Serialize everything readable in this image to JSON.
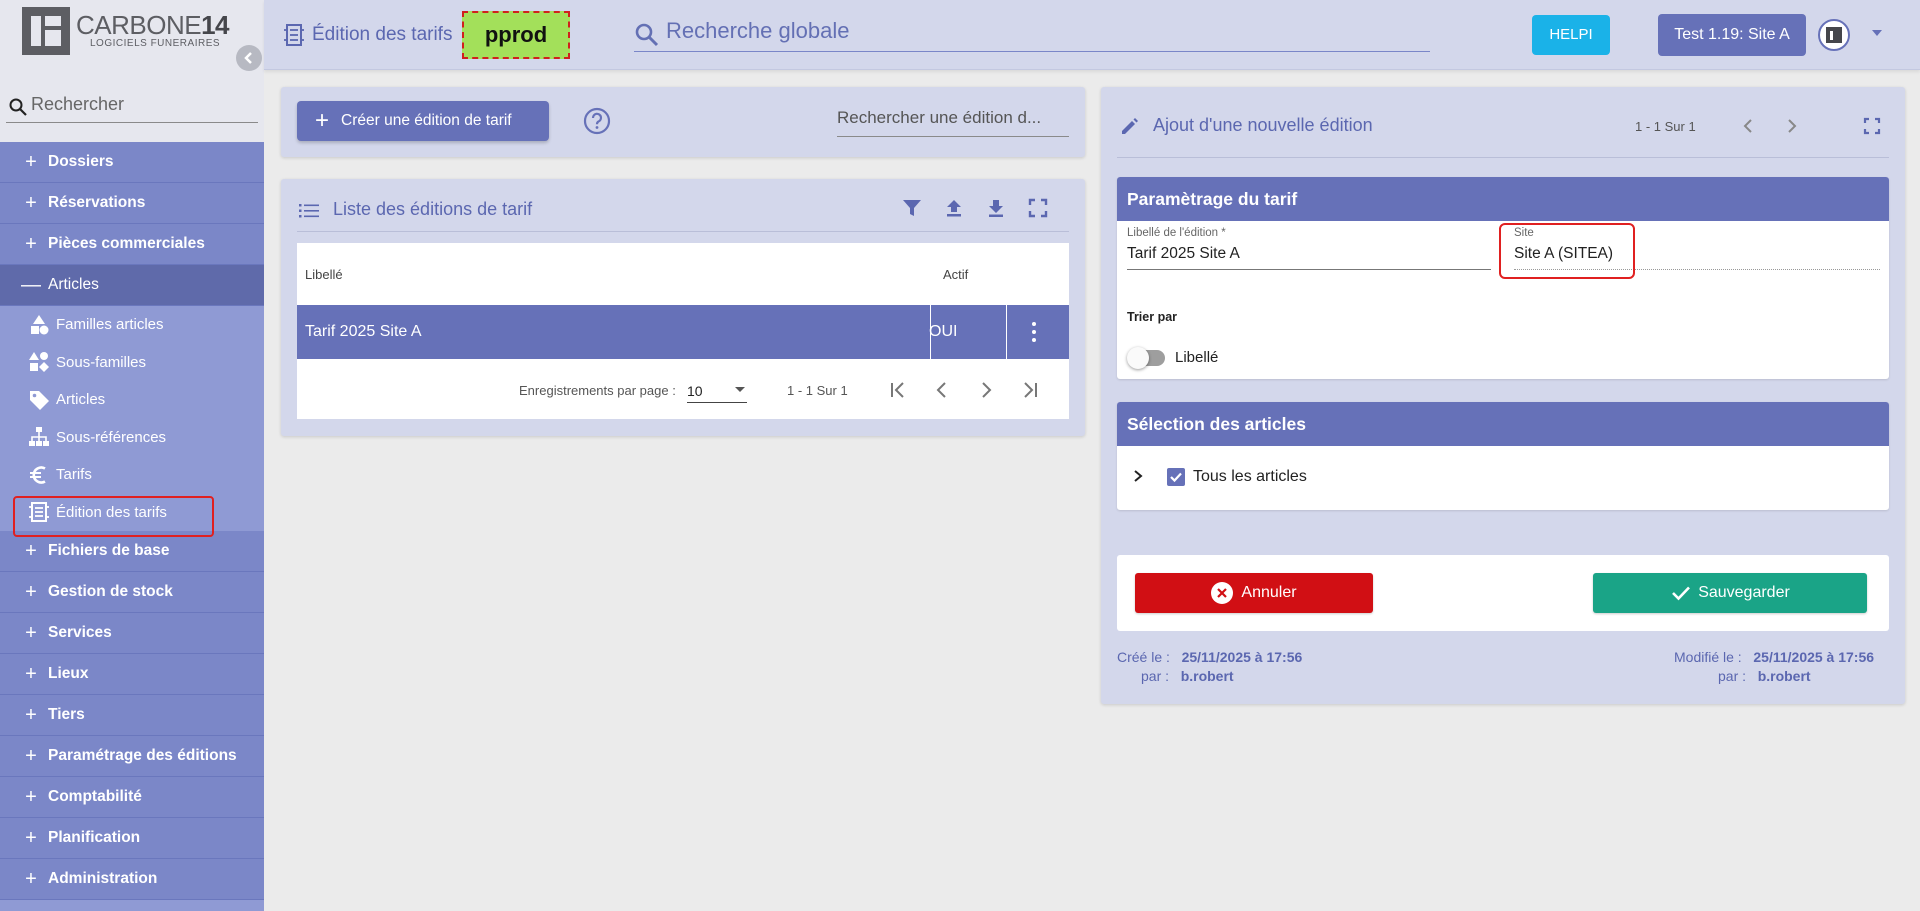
{
  "brand": {
    "name_light": "CARBONE",
    "name_bold": "14",
    "tagline": "LOGICIELS FUNERAIRES"
  },
  "sidebar": {
    "search_placeholder": "Rechercher",
    "items": [
      {
        "label": "Dossiers",
        "symbol": "+"
      },
      {
        "label": "Réservations",
        "symbol": "+"
      },
      {
        "label": "Pièces commerciales",
        "symbol": "+"
      },
      {
        "label": "Articles",
        "symbol": "—"
      },
      {
        "label": "Fichiers de base",
        "symbol": "+"
      },
      {
        "label": "Gestion de stock",
        "symbol": "+"
      },
      {
        "label": "Services",
        "symbol": "+"
      },
      {
        "label": "Lieux",
        "symbol": "+"
      },
      {
        "label": "Tiers",
        "symbol": "+"
      },
      {
        "label": "Paramétrage des éditions",
        "symbol": "+"
      },
      {
        "label": "Comptabilité",
        "symbol": "+"
      },
      {
        "label": "Planification",
        "symbol": "+"
      },
      {
        "label": "Administration",
        "symbol": "+"
      }
    ],
    "subitems": [
      {
        "label": "Familles articles",
        "icon": "shapes-icon"
      },
      {
        "label": "Sous-familles",
        "icon": "shapes-multi-icon"
      },
      {
        "label": "Articles",
        "icon": "tag-icon"
      },
      {
        "label": "Sous-références",
        "icon": "sitemap-icon"
      },
      {
        "label": "Tarifs",
        "icon": "euro-icon"
      },
      {
        "label": "Édition des tarifs",
        "icon": "receipt-icon"
      }
    ]
  },
  "header": {
    "title": "Édition des tarifs",
    "env_badge": "pprod",
    "search_placeholder": "Recherche globale",
    "helpi_label": "HELPI",
    "site_label": "Test 1.19: Site A"
  },
  "toolbar": {
    "create_label": "Créer une édition de tarif",
    "search_placeholder": "Rechercher une édition d..."
  },
  "list": {
    "title": "Liste des éditions de tarif",
    "columns": [
      "Libellé",
      "Actif"
    ],
    "rows": [
      {
        "libelle": "Tarif 2025 Site A",
        "actif": "OUI"
      }
    ],
    "per_page_label": "Enregistrements par page :",
    "per_page_value": "10",
    "count": "1 - 1 Sur 1"
  },
  "editor": {
    "title": "Ajout d'une nouvelle édition",
    "count": "1 - 1 Sur 1",
    "param_section": "Paramètrage du tarif",
    "libelle_label": "Libellé de l'édition *",
    "libelle_value": "Tarif 2025 Site A",
    "site_label": "Site",
    "site_value": "Site A (SITEA)",
    "sort_label": "Trier par",
    "sort_option": "Libellé",
    "selection_section": "Sélection des articles",
    "all_articles_label": "Tous les articles",
    "cancel_label": "Annuler",
    "save_label": "Sauvegarder"
  },
  "meta": {
    "created_label": "Créé le :",
    "created_value": "25/11/2025 à 17:56",
    "created_by_label": "par :",
    "created_by": "b.robert",
    "modified_label": "Modifié le :",
    "modified_value": "25/11/2025 à 17:56",
    "modified_by_label": "par :",
    "modified_by": "b.robert"
  },
  "colors": {
    "primary": "#6671b8",
    "sidebar": "#8f9ad4",
    "cancel": "#d10f14",
    "save": "#1aa487",
    "helpi": "#1ab2e8",
    "env_badge": "#a3e05a"
  }
}
